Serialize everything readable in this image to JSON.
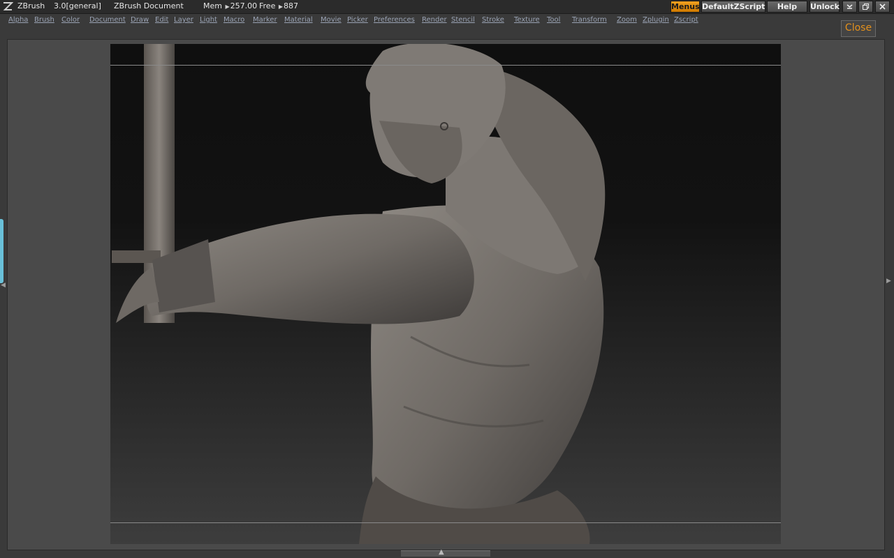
{
  "titlebar": {
    "app_name": "ZBrush",
    "version": "3.0[general]",
    "document": "ZBrush Document",
    "mem_label": "Mem",
    "mem_value": "257.00",
    "free_label": "Free",
    "free_value": "887",
    "buttons": {
      "menus": "Menus",
      "default_zscript": "DefaultZScript",
      "help": "Help",
      "unlock": "Unlock"
    },
    "window_controls": [
      "minimize-icon",
      "restore-icon",
      "close-icon"
    ]
  },
  "menu": {
    "items": [
      "Alpha",
      "Brush",
      "Color",
      "Document",
      "Draw",
      "Edit",
      "Layer",
      "Light",
      "Macro",
      "Marker",
      "Material",
      "Movie",
      "Picker",
      "Preferences",
      "Render",
      "Stencil",
      "Stroke",
      "Texture",
      "Tool",
      "Transform",
      "Zoom",
      "Zplugin",
      "Zscript"
    ],
    "close_label": "Close"
  },
  "colors": {
    "accent": "#e3901c",
    "menu_text": "#9aa3b4",
    "background": "#3a3a3a",
    "left_tab": "#69c0d8"
  }
}
